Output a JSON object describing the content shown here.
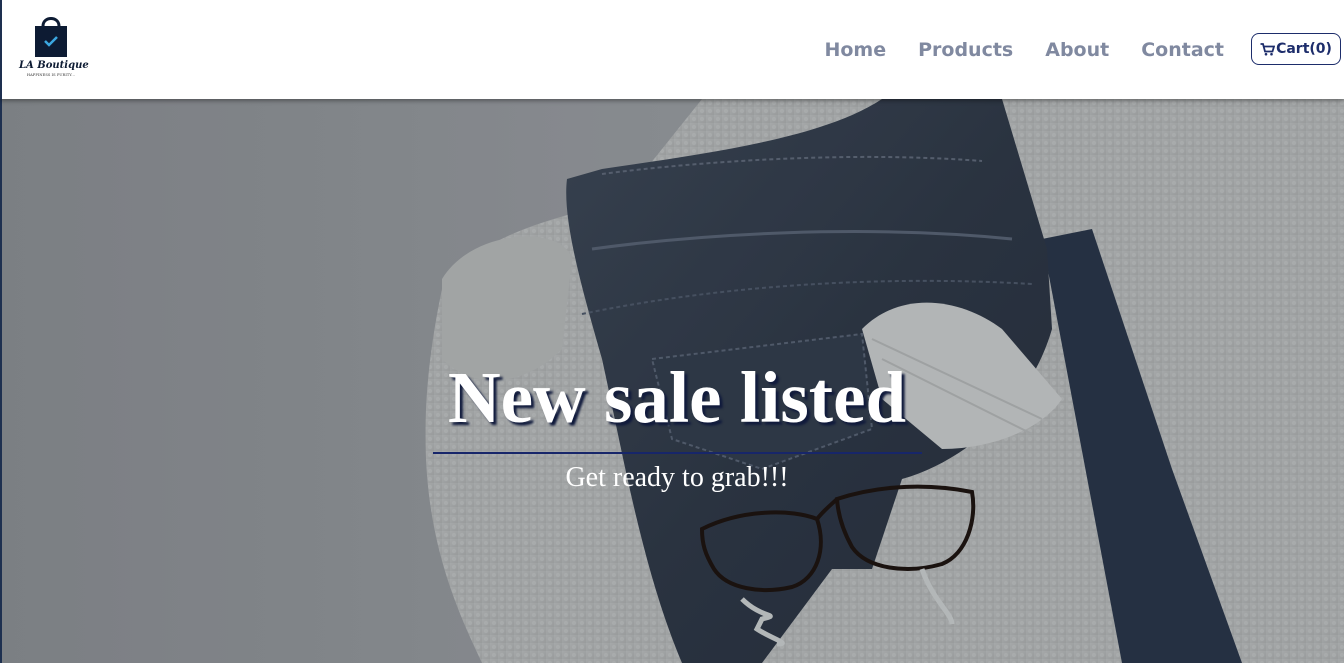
{
  "brand": {
    "name": "LA Boutique",
    "tagline": "HAPPINESS IS PURITY..."
  },
  "nav": {
    "items": [
      {
        "label": "Home"
      },
      {
        "label": "Products"
      },
      {
        "label": "About"
      },
      {
        "label": "Contact"
      }
    ],
    "cart_label": "Cart(0)"
  },
  "hero": {
    "title": "New sale listed",
    "subtitle": "Get ready to grab!!!"
  },
  "icons": {
    "logo": "shopping-bag-icon",
    "cart": "cart-icon"
  },
  "colors": {
    "nav_text": "#8089a0",
    "brand_navy": "#1d2d6b",
    "hero_text": "#ffffff"
  }
}
